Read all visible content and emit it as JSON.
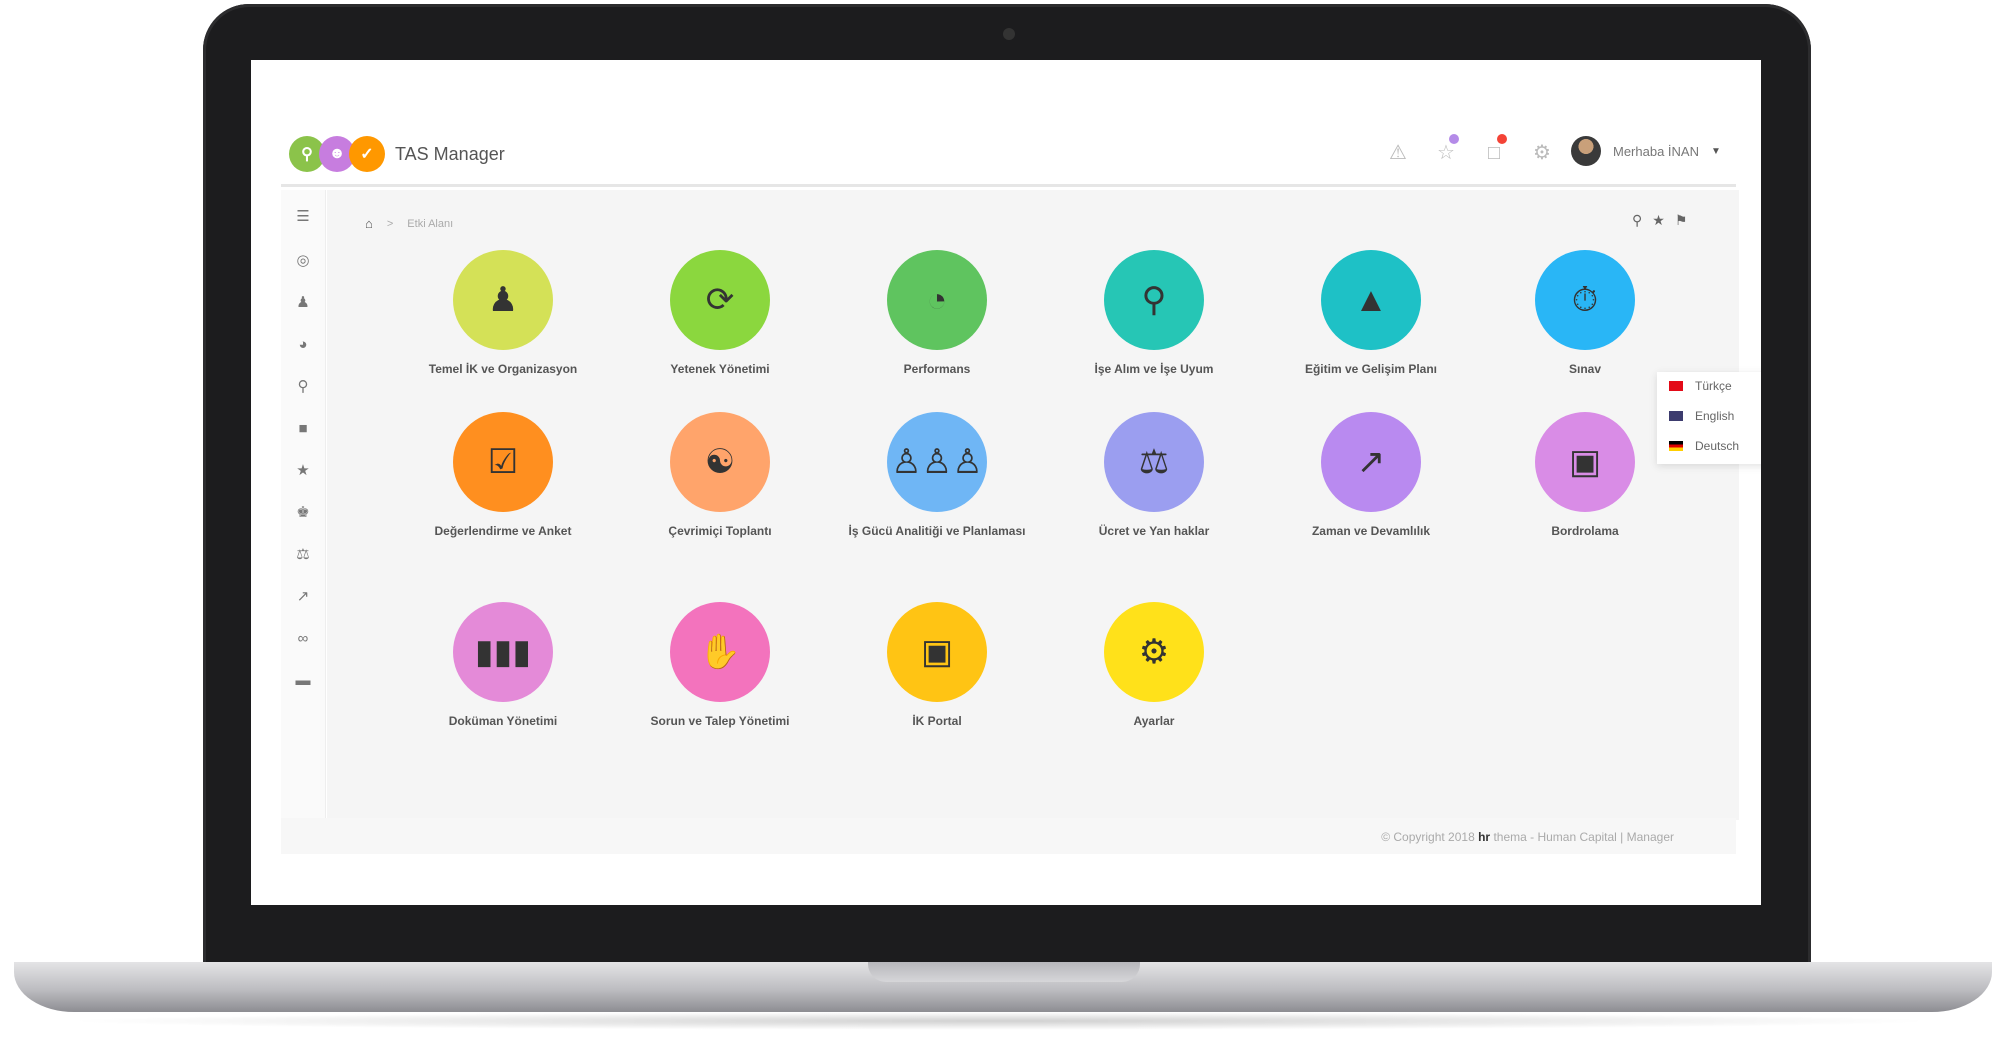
{
  "app": {
    "title": "TAS Manager",
    "logo_colors": [
      "#8bc34a",
      "#c77ddf",
      "#ff9800"
    ]
  },
  "header": {
    "greeting": "Merhaba İNAN",
    "icons": [
      "bell-icon",
      "favorites-icon",
      "document-alert-icon",
      "gear-icon"
    ],
    "badge_colors": {
      "favorites": "#b48be8",
      "documents": "#f44336"
    }
  },
  "breadcrumb": {
    "current": "Etki Alanı"
  },
  "sidebar": {
    "icons": [
      "menu-icon",
      "dashboard-icon",
      "user-icon",
      "performance-icon",
      "recruitment-icon",
      "education-icon",
      "award-icon",
      "group-icon",
      "balance-icon",
      "chart-icon",
      "link-icon",
      "folder-icon"
    ]
  },
  "modules": [
    {
      "label": "Temel İK ve Organizasyon",
      "color": "#d4e157",
      "icon": "person-icon"
    },
    {
      "label": "Yetenek Yönetimi",
      "color": "#8bd73e",
      "icon": "talent-cycle-icon"
    },
    {
      "label": "Performans",
      "color": "#5fc45f",
      "icon": "gauge-icon"
    },
    {
      "label": "İşe Alım ve İşe Uyum",
      "color": "#26c6b5",
      "icon": "search-person-icon"
    },
    {
      "label": "Eğitim ve Gelişim Planı",
      "color": "#1ec1c6",
      "icon": "graduation-cap-icon"
    },
    {
      "label": "Sınav",
      "color": "#29b6f6",
      "icon": "exam-icon"
    },
    {
      "label": "Değerlendirme ve Anket",
      "color": "#ff8f1f",
      "icon": "clipboard-check-icon"
    },
    {
      "label": "Çevrimiçi Toplantı",
      "color": "#ffa46b",
      "icon": "meeting-icon"
    },
    {
      "label": "İş Gücü Analitiği ve Planlaması",
      "color": "#6fb6f5",
      "icon": "workforce-icon"
    },
    {
      "label": "Ücret ve Yan haklar",
      "color": "#9b9ef0",
      "icon": "scale-icon"
    },
    {
      "label": "Zaman ve Devamlılık",
      "color": "#b98af0",
      "icon": "time-chart-icon"
    },
    {
      "label": "Bordrolama",
      "color": "#d98ce6",
      "icon": "money-stack-icon"
    },
    {
      "label": "Doküman Yönetimi",
      "color": "#e48ad8",
      "icon": "binders-icon"
    },
    {
      "label": "Sorun ve Talep Yönetimi",
      "color": "#f373bd",
      "icon": "puzzle-hand-icon"
    },
    {
      "label": "İK Portal",
      "color": "#ffc414",
      "icon": "monitor-globe-icon"
    },
    {
      "label": "Ayarlar",
      "color": "#ffe11a",
      "icon": "settings-gear-icon"
    }
  ],
  "language_menu": {
    "items": [
      {
        "label": "Türkçe",
        "selected": true,
        "flag_color": "#e30a17"
      },
      {
        "label": "English",
        "selected": false,
        "flag_color": "#3c3b6e"
      },
      {
        "label": "Deutsch",
        "selected": false,
        "flag_color": "#dd0000"
      }
    ]
  },
  "footer": {
    "copyright": "© Copyright 2018",
    "brand_hr": "hr",
    "brand_name": "thema",
    "suffix": "- Human Capital | Manager"
  }
}
